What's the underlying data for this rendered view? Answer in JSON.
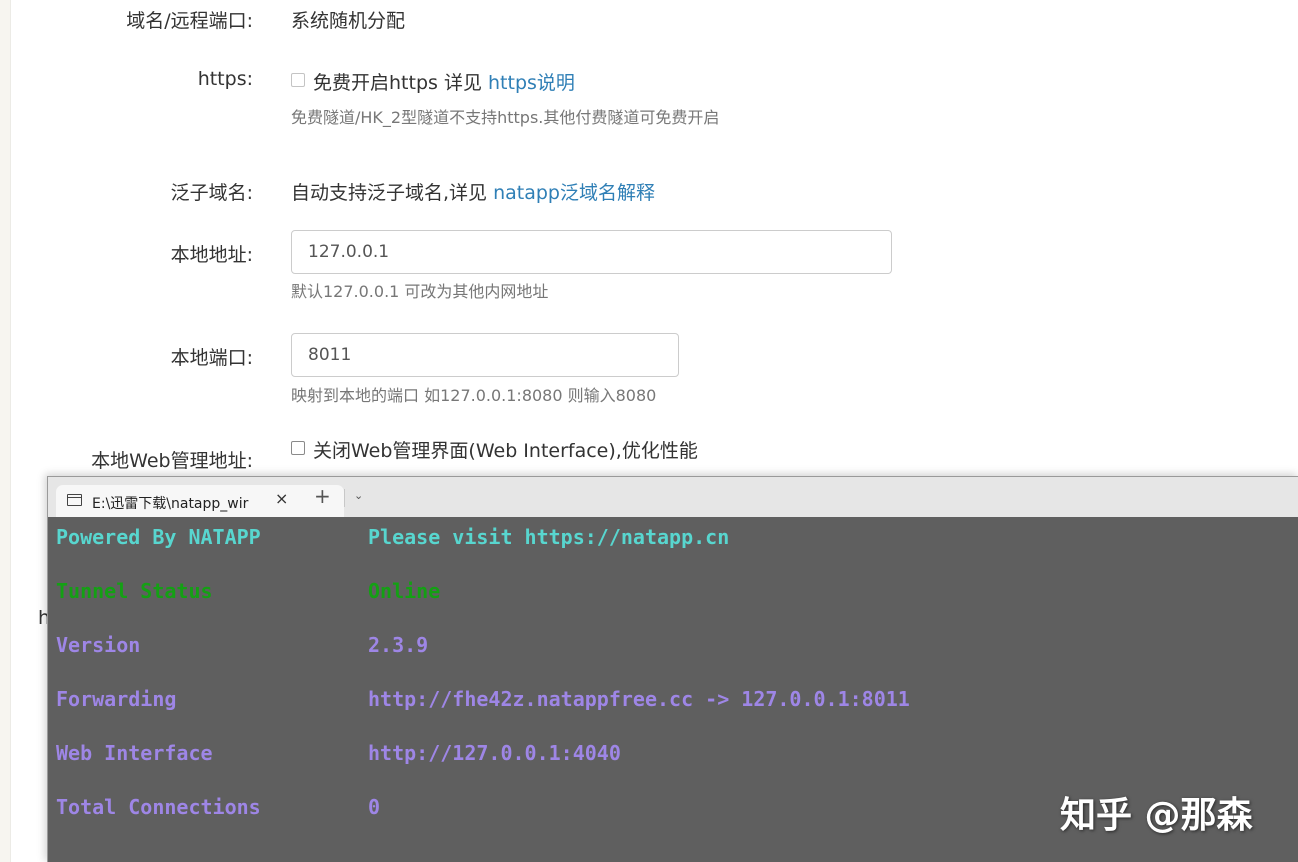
{
  "form": {
    "domain_port": {
      "label": "域名/远程端口:",
      "value": "系统随机分配"
    },
    "https": {
      "label": "https:",
      "checkbox_label": "免费开启https 详见",
      "link": "https说明",
      "hint": "免费隧道/HK_2型隧道不支持https.其他付费隧道可免费开启"
    },
    "wildcard": {
      "label": "泛子域名:",
      "text": "自动支持泛子域名,详见",
      "link": "natapp泛域名解释"
    },
    "local_addr": {
      "label": "本地地址:",
      "value": "127.0.0.1",
      "hint": "默认127.0.0.1 可改为其他内网地址"
    },
    "local_port": {
      "label": "本地端口:",
      "value": "8011",
      "hint": "映射到本地的端口 如127.0.0.1:8080 则输入8080"
    },
    "web_admin": {
      "label": "本地Web管理地址:",
      "checkbox_label": "关闭Web管理界面(Web Interface),优化性能"
    },
    "stray_char": "h"
  },
  "terminal": {
    "tab": {
      "title": "E:\\迅雷下载\\natapp_wir",
      "icon": "terminal-icon",
      "close": "×",
      "new_tab": "+",
      "dropdown": "⌄"
    },
    "rows": [
      {
        "key": "Powered By NATAPP",
        "value": "Please visit https://natapp.cn"
      },
      {
        "key": "Tunnel Status",
        "value": "Online"
      },
      {
        "key": "Version",
        "value": "2.3.9"
      },
      {
        "key": "Forwarding",
        "value": "http://fhe42z.natappfree.cc -> 127.0.0.1:8011"
      },
      {
        "key": "Web Interface",
        "value": "http://127.0.0.1:4040"
      },
      {
        "key": "Total Connections",
        "value": "0"
      }
    ],
    "colors": {
      "background": "#5f5f5f",
      "cyan": "#58d6cf",
      "green": "#14a014",
      "purple": "#9e86e6"
    }
  },
  "watermark": "知乎 @那森"
}
